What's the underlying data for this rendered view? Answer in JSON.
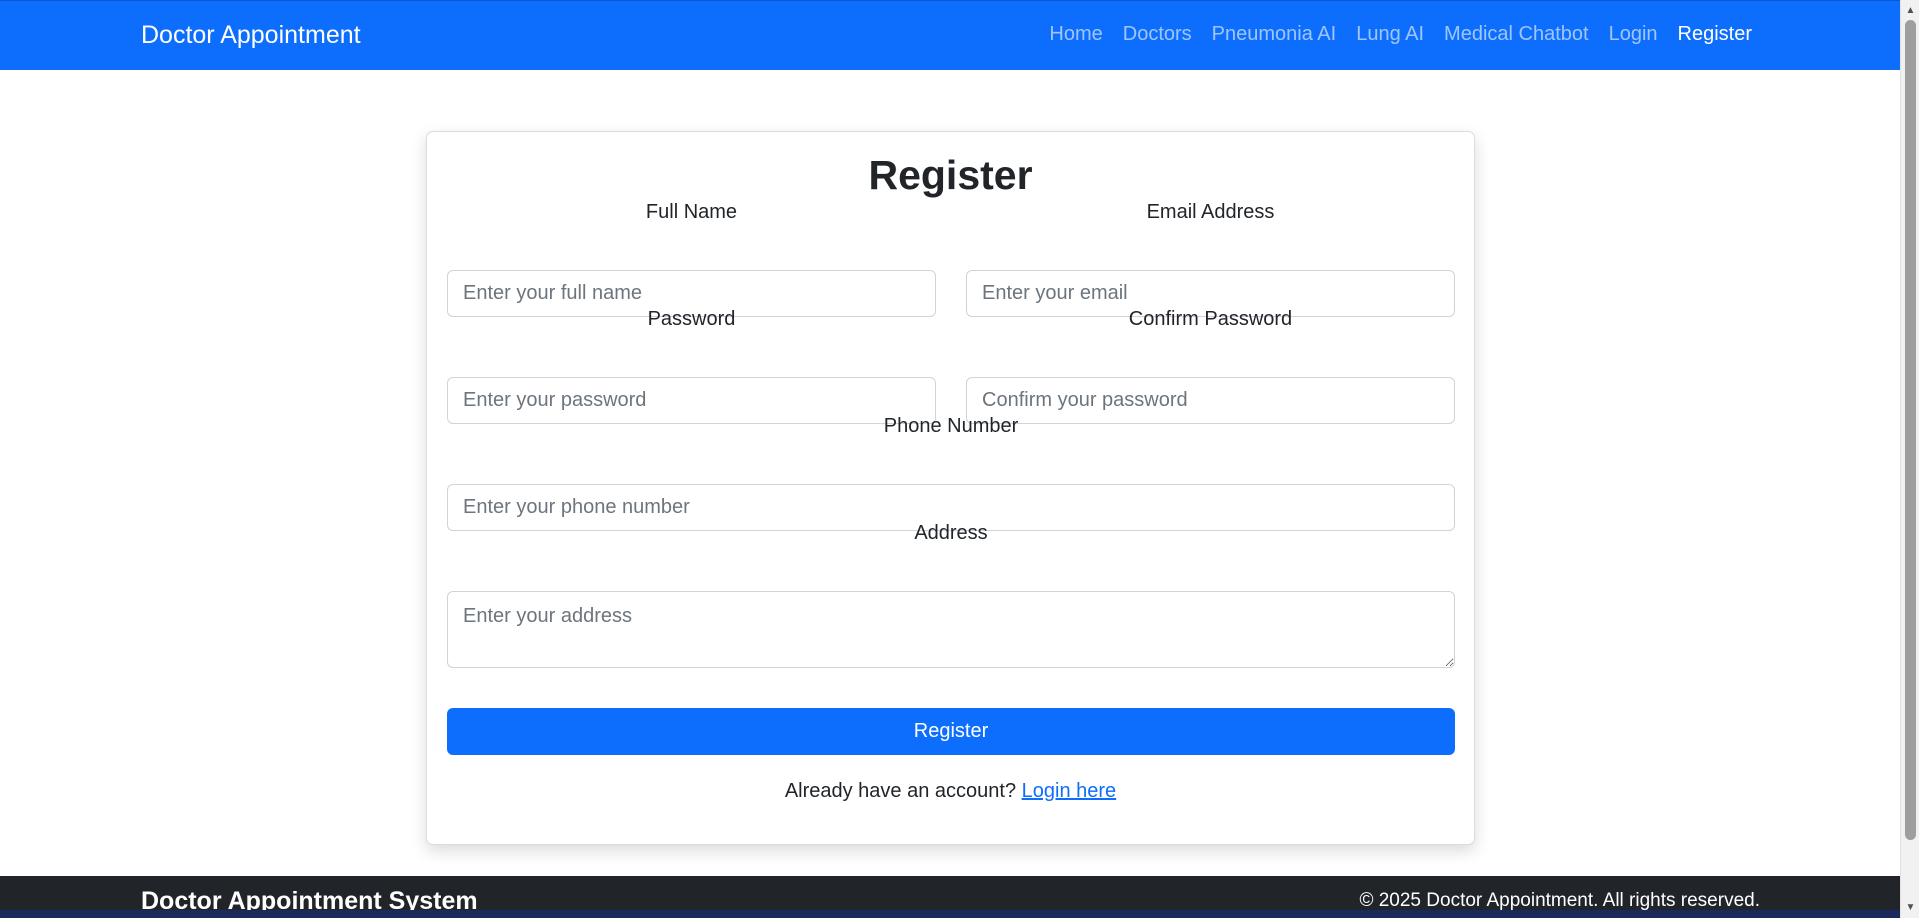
{
  "navbar": {
    "brand": "Doctor Appointment",
    "links": [
      {
        "label": "Home"
      },
      {
        "label": "Doctors"
      },
      {
        "label": "Pneumonia AI"
      },
      {
        "label": "Lung AI"
      },
      {
        "label": "Medical Chatbot"
      },
      {
        "label": "Login"
      },
      {
        "label": "Register"
      }
    ],
    "active": "Register",
    "color": "#0d6efd"
  },
  "form": {
    "title": "Register",
    "full_name": {
      "label": "Full Name",
      "placeholder": "Enter your full name",
      "value": ""
    },
    "email": {
      "label": "Email Address",
      "placeholder": "Enter your email",
      "value": ""
    },
    "password": {
      "label": "Password",
      "placeholder": "Enter your password",
      "value": ""
    },
    "confirm_password": {
      "label": "Confirm Password",
      "placeholder": "Confirm your password",
      "value": ""
    },
    "phone": {
      "label": "Phone Number",
      "placeholder": "Enter your phone number",
      "value": ""
    },
    "address": {
      "label": "Address",
      "placeholder": "Enter your address",
      "value": ""
    },
    "submit_label": "Register",
    "login_prompt": "Already have an account?",
    "login_link": "Login here"
  },
  "footer": {
    "brand": "Doctor Appointment System",
    "copyright": "© 2025 Doctor Appointment. All rights reserved.",
    "color": "#212529"
  },
  "icons": {
    "scroll_up": "triangle-up-icon",
    "scroll_down": "triangle-down-icon"
  }
}
